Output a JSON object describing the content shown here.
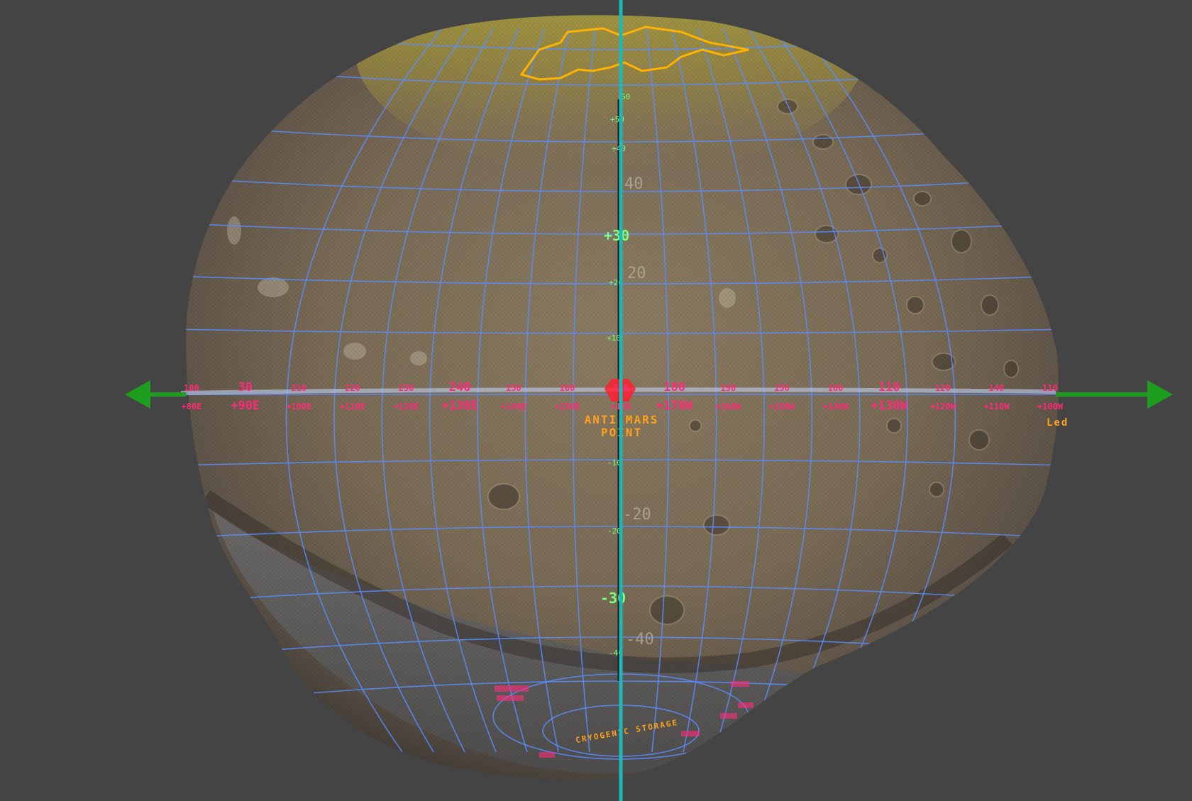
{
  "viewport": {
    "background": "#444444",
    "axis_color": "#1fb8b8",
    "arrow_color": "#1e9e1e",
    "grid_color": "#5a8cff",
    "label_green": "#7cff7c",
    "label_pink": "#ff2b7a",
    "label_orange": "#ffa11a"
  },
  "annotation": {
    "line1": "ANTI-MARS",
    "line2": "POINT"
  },
  "bottom_label": "CRYOGENIC STORAGE",
  "right_label": "Led",
  "latitude_labels": {
    "p60": "60",
    "p50": "+50",
    "p40": "+40",
    "p30": "+30",
    "p20": "+20",
    "p10": "+10",
    "m10": "-10",
    "m20": "-20",
    "m30": "-30",
    "m40": "-40"
  },
  "latitude_ghost_labels": {
    "g40": "40",
    "g20": "20",
    "gm20": "-20",
    "gm40": "-40"
  },
  "longitude_labels_top": [
    "180",
    "30",
    "210",
    "220",
    "230",
    "240",
    "150",
    "160",
    "170",
    "180",
    "190",
    "150",
    "160",
    "110",
    "120",
    "140",
    "110"
  ],
  "longitude_labels_bottom": [
    "+80E",
    "+90E",
    "+100E",
    "+110E",
    "+120E",
    "+130E",
    "+140E",
    "+150E",
    "+180",
    "+170W",
    "+160W",
    "+150W",
    "+140W",
    "+130W",
    "+120W",
    "+110W",
    "+100W"
  ]
}
